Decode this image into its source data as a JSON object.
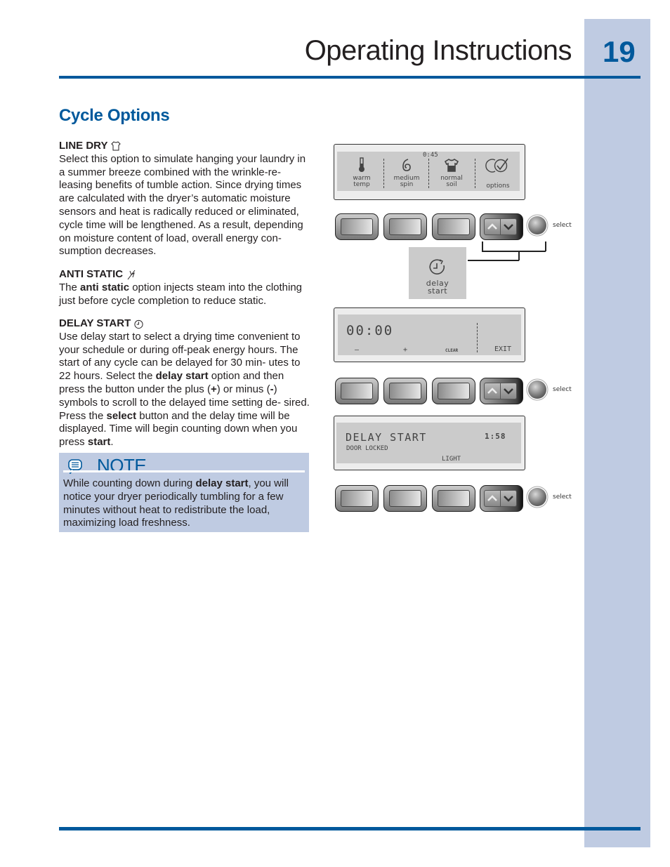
{
  "header": {
    "title": "Operating Instructions",
    "page_number": "19"
  },
  "section": {
    "title": "Cycle Options"
  },
  "options": [
    {
      "heading": "LINE DRY",
      "icon": "shirt-icon",
      "body": "Select this option to simulate hanging your laundry in a summer breeze combined with the wrinkle-re- leasing benefits of tumble action. Since drying times are calculated with the dryer’s automatic moisture sensors and heat is radically reduced or eliminated, cycle time will be lengthened. As a result, depending on moisture content of load, overall energy con- sumption decreases."
    },
    {
      "heading": "ANTI STATIC",
      "icon": "anti-static-icon",
      "body_pre": "The ",
      "body_bold": "anti static",
      "body_post": " option injects steam into the clothing just before cycle completion to reduce static."
    },
    {
      "heading": "DELAY START",
      "icon": "clock-icon",
      "body_1": "Use delay start to select a drying time convenient to your schedule or during off-peak energy hours. The start of any cycle can be delayed for 30 min- utes to 22 hours. Select the ",
      "bold_1": "delay start",
      "body_2": " option and then press the button under the plus (",
      "bold_2": "+",
      "body_3": ") or minus (",
      "bold_3": "-",
      "body_4": ") symbols to scroll to the delayed time setting de- sired. Press the ",
      "bold_4": "select",
      "body_5": " button and the delay time will be displayed. Time will begin counting down when you press ",
      "bold_5": "start",
      "body_6": "."
    }
  ],
  "note": {
    "label": "NOTE",
    "icon": "speech-bubble-icon",
    "text_pre": "While counting down during ",
    "text_bold": "delay start",
    "text_post": ", you will notice your dryer periodically tumbling for a few minutes without heat to redistribute the load, maximizing load freshness."
  },
  "diagram": {
    "display1": {
      "time": "0:45",
      "items": [
        {
          "icon": "thermometer-icon",
          "line1": "warm",
          "line2": "temp"
        },
        {
          "icon": "spiral-icon",
          "line1": "medium",
          "line2": "spin"
        },
        {
          "icon": "shirt-soil-icon",
          "line1": "normal",
          "line2": "soil"
        },
        {
          "icon": "options-check-icon",
          "line1": "",
          "line2": "options"
        }
      ]
    },
    "select_label": "select",
    "delay_tile": {
      "icon": "delay-clock-icon",
      "line1": "delay",
      "line2": "start"
    },
    "display2": {
      "time": "00:00",
      "minus": "–",
      "plus": "+",
      "clear": "CLEAR",
      "exit": "EXIT"
    },
    "display3": {
      "title": "DELAY START",
      "time": "1:58",
      "status": "DOOR LOCKED",
      "level": "LIGHT"
    }
  }
}
